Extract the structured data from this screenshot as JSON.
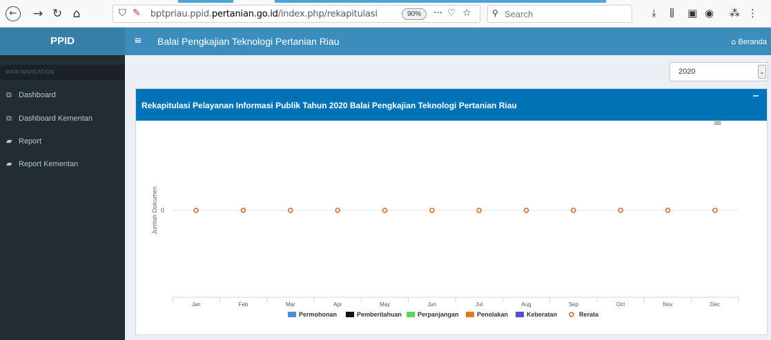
{
  "browser": {
    "url_prefix": "bptpriau.ppid.",
    "url_domain": "pertanian.go.id",
    "url_suffix": "/index.php/rekapitulasi",
    "zoom": "90%",
    "search_placeholder": "Search"
  },
  "header": {
    "logo": "PPID",
    "menu_icon": "hamburger-icon",
    "title": "Balai Pengkajian Teknologi Pertanian Riau",
    "home_link": "Beranda"
  },
  "sidebar": {
    "nav_header": "MAIN NAVIGATION",
    "items": [
      {
        "label": "Dashboard",
        "icon": "dashboard-icon"
      },
      {
        "label": "Dashboard Kementan",
        "icon": "dashboard-icon"
      },
      {
        "label": "Report",
        "icon": "book-icon"
      },
      {
        "label": "Report Kementan",
        "icon": "book-icon"
      }
    ]
  },
  "filter": {
    "year_selected": "2020"
  },
  "box": {
    "title": "Rekapitulasi Pelayanan Informasi Publik Tahun 2020 Balai Pengkajian Teknologi Pertanian Riau"
  },
  "colors": {
    "header": "#3c8dbc",
    "box_header": "#0073b7",
    "sidebar": "#222d32",
    "rerata": "#d2691e"
  },
  "chart_data": {
    "type": "line",
    "ylabel": "Jumlah Dokumen",
    "categories": [
      "Jan",
      "Feb",
      "Mar",
      "Apr",
      "May",
      "Jun",
      "Jul",
      "Aug",
      "Sep",
      "Oct",
      "Nov",
      "Dec"
    ],
    "yticks": [
      0
    ],
    "series": [
      {
        "name": "Permohonan",
        "type": "bar",
        "color": "#4a90d9",
        "values": [
          0,
          0,
          0,
          0,
          0,
          0,
          0,
          0,
          0,
          0,
          0,
          0
        ]
      },
      {
        "name": "Pemberitahuan",
        "type": "bar",
        "color": "#111111",
        "values": [
          0,
          0,
          0,
          0,
          0,
          0,
          0,
          0,
          0,
          0,
          0,
          0
        ]
      },
      {
        "name": "Perpanjangan",
        "type": "bar",
        "color": "#5cd65c",
        "values": [
          0,
          0,
          0,
          0,
          0,
          0,
          0,
          0,
          0,
          0,
          0,
          0
        ]
      },
      {
        "name": "Penolakan",
        "type": "bar",
        "color": "#e07b1a",
        "values": [
          0,
          0,
          0,
          0,
          0,
          0,
          0,
          0,
          0,
          0,
          0,
          0
        ]
      },
      {
        "name": "Keberatan",
        "type": "bar",
        "color": "#5050d0",
        "values": [
          0,
          0,
          0,
          0,
          0,
          0,
          0,
          0,
          0,
          0,
          0,
          0
        ]
      },
      {
        "name": "Rerata",
        "type": "line",
        "color": "#d2691e",
        "values": [
          0,
          0,
          0,
          0,
          0,
          0,
          0,
          0,
          0,
          0,
          0,
          0
        ]
      }
    ],
    "legend_position": "bottom-center",
    "grid": false
  }
}
